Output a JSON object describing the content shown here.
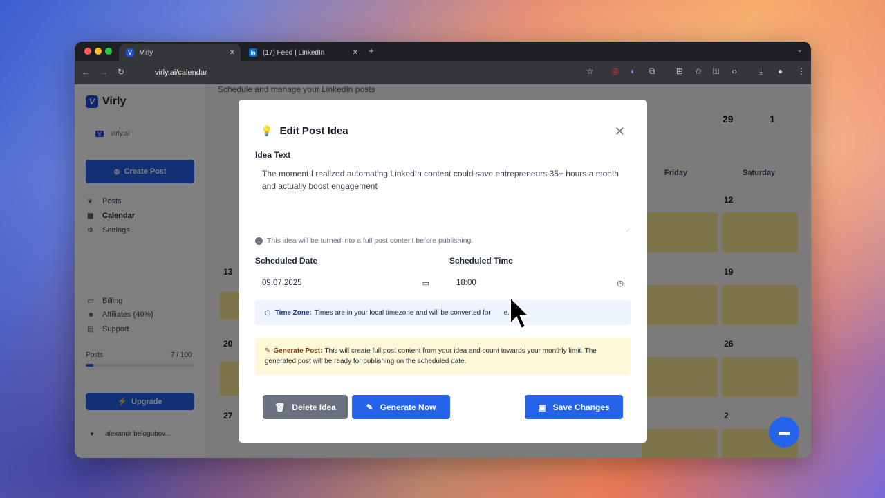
{
  "browser": {
    "tabs": [
      {
        "label": "Virly",
        "favicon": "V"
      },
      {
        "label": "(17) Feed | LinkedIn",
        "favicon": "in"
      }
    ],
    "url": "virly.ai/calendar"
  },
  "sidebar": {
    "app_name": "Virly",
    "workspace": "virly.ai",
    "create_post": "Create Post",
    "nav": [
      {
        "label": "Posts",
        "icon": "leaf-icon"
      },
      {
        "label": "Calendar",
        "icon": "calendar-icon"
      },
      {
        "label": "Settings",
        "icon": "gear-icon"
      }
    ],
    "bottom_nav": [
      {
        "label": "Billing",
        "icon": "card-icon"
      },
      {
        "label": "Affiliates (40%)",
        "icon": "users-icon"
      },
      {
        "label": "Support",
        "icon": "chat-icon"
      }
    ],
    "posts_label": "Posts",
    "posts_count": "7 / 100",
    "posts_fraction": 0.07,
    "upgrade": "Upgrade",
    "user": "alexandr belogubov..."
  },
  "main": {
    "subtitle": "Schedule and manage your LinkedIn posts",
    "stats": [
      "29",
      "1"
    ],
    "days": [
      "Friday",
      "Saturday"
    ],
    "left_dates": [
      "13",
      "20",
      "27"
    ],
    "right_dates": [
      "12",
      "19",
      "26",
      "2"
    ]
  },
  "modal": {
    "title": "Edit Post Idea",
    "idea_label": "Idea Text",
    "idea_text": "The moment I realized automating LinkedIn content could save entrepreneurs 35+ hours a month and actually boost engagement",
    "hint": "This idea will be turned into a full post content before publishing.",
    "date_label": "Scheduled Date",
    "date_value": "09.07.2025",
    "time_label": "Scheduled Time",
    "time_value": "18:00",
    "tz_title": "Time Zone:",
    "tz_text": "Times are in your local timezone and will be converted for",
    "tz_text_end": "e.",
    "gen_title": "Generate Post:",
    "gen_text": "This will create full post content from your idea and count towards your monthly limit. The generated post will be ready for publishing on the scheduled date.",
    "delete": "Delete Idea",
    "generate": "Generate Now",
    "save": "Save Changes"
  },
  "colors": {
    "primary": "#2563eb",
    "delete": "#6b7280",
    "warning_bg": "#fef8d8",
    "info_bg": "#eef4ff"
  }
}
